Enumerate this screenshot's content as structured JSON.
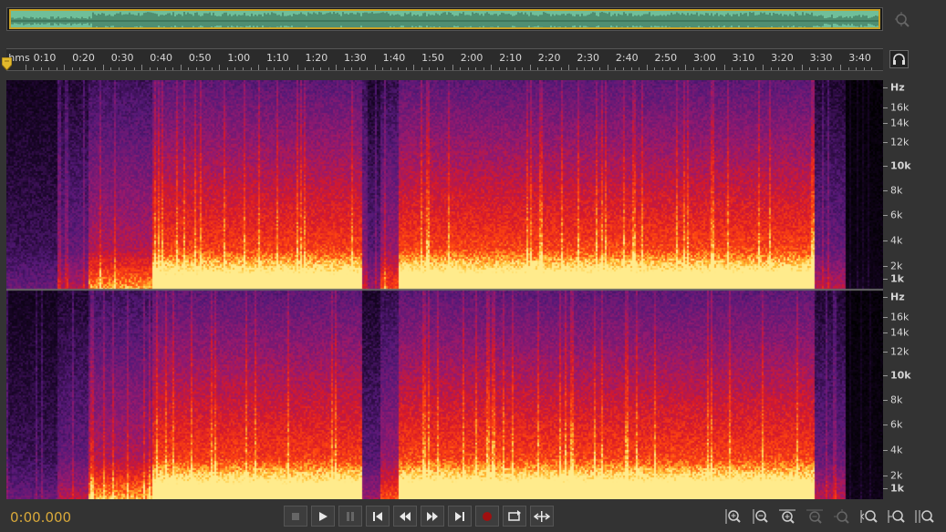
{
  "overview": {
    "selection_color": "#6fbf9a",
    "handle_color": "#c9a227"
  },
  "ruler": {
    "unit_label": "hms",
    "ticks": [
      "0:10",
      "0:20",
      "0:30",
      "0:40",
      "0:50",
      "1:00",
      "1:10",
      "1:20",
      "1:30",
      "1:40",
      "1:50",
      "2:00",
      "2:10",
      "2:20",
      "2:30",
      "2:40",
      "2:50",
      "3:00",
      "3:10",
      "3:20",
      "3:30",
      "3:40"
    ]
  },
  "frequency_axis": {
    "channels": [
      {
        "labels": [
          "Hz",
          "16k",
          "14k",
          "12k",
          "10k",
          "8k",
          "6k",
          "4k",
          "2k",
          "1k"
        ]
      },
      {
        "labels": [
          "Hz",
          "16k",
          "14k",
          "12k",
          "10k",
          "8k",
          "6k",
          "4k",
          "2k",
          "1k"
        ]
      }
    ]
  },
  "transport": {
    "timecode": "0:00.000",
    "buttons": [
      "stop-icon",
      "play-icon",
      "pause-icon",
      "move-to-previous-icon",
      "rewind-icon",
      "fast-forward-icon",
      "move-to-next-icon",
      "record-icon",
      "loop-playback-icon",
      "skip-selection-icon"
    ]
  },
  "zoom_controls": [
    "zoom-in-amplitude-icon",
    "zoom-out-amplitude-icon",
    "zoom-in-time-icon",
    "zoom-out-time-icon",
    "zoom-out-full-icon",
    "zoom-in-at-in-point-icon",
    "zoom-in-at-out-point-icon",
    "zoom-to-selection-icon"
  ],
  "colors": {
    "timecode": "#d9a93a",
    "spectral_low": "#000000",
    "spectral_mid": "#5a1a7a",
    "spectral_high": "#ff2a10",
    "spectral_peak": "#ffd040",
    "record": "#a01010"
  }
}
